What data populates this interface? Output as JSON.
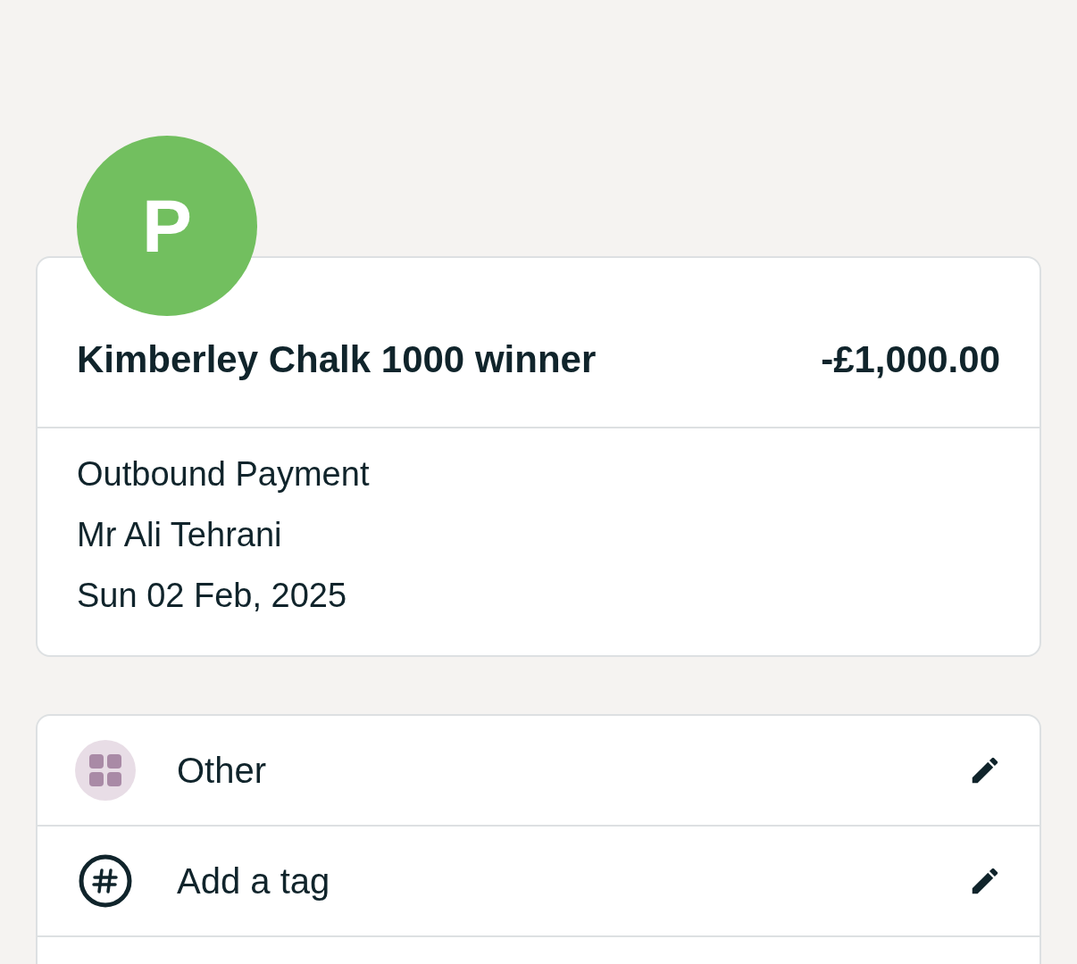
{
  "avatar": {
    "letter": "P",
    "color": "#72bf5f"
  },
  "transaction": {
    "title": "Kimberley Chalk 1000 winner",
    "amount": "-£1,000.00",
    "details": [
      "Outbound Payment",
      "Mr Ali Tehrani",
      "Sun 02 Feb, 2025"
    ]
  },
  "actions": [
    {
      "kind": "category",
      "label": "Other"
    },
    {
      "kind": "tag",
      "label": "Add a tag"
    }
  ]
}
